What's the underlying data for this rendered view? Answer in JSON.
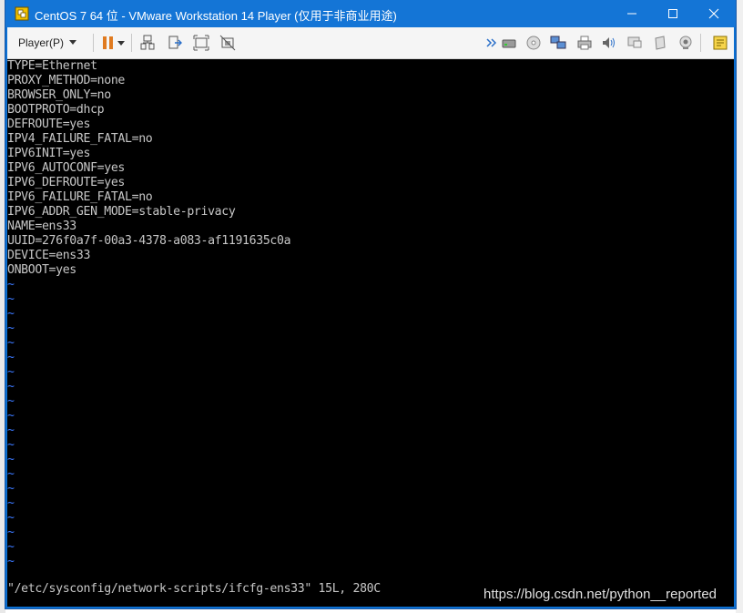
{
  "window": {
    "title": "CentOS 7 64 位 - VMware Workstation 14 Player (仅用于非商业用途)",
    "app_icon": "vmware-icon",
    "controls": [
      "minimize-icon",
      "maximize-icon",
      "close-icon"
    ]
  },
  "toolbar": {
    "player_menu": "Player(P)",
    "icons_left": [
      "pause-icon",
      "send-ctrl-alt-del-icon",
      "snapshot-icon",
      "fullscreen-icon",
      "unity-icon"
    ],
    "icons_right": [
      "more-icon",
      "hard-disk-icon",
      "cd-icon",
      "network-icon",
      "printer-icon",
      "sound-icon",
      "display-icon",
      "usb-icon",
      "camera-icon",
      "message-icon"
    ]
  },
  "terminal": {
    "lines": [
      "TYPE=Ethernet",
      "PROXY_METHOD=none",
      "BROWSER_ONLY=no",
      "BOOTPROTO=dhcp",
      "DEFROUTE=yes",
      "IPV4_FAILURE_FATAL=no",
      "IPV6INIT=yes",
      "IPV6_AUTOCONF=yes",
      "IPV6_DEFROUTE=yes",
      "IPV6_FAILURE_FATAL=no",
      "IPV6_ADDR_GEN_MODE=stable-privacy",
      "NAME=ens33",
      "UUID=276f0a7f-00a3-4378-a083-af1191635c0a",
      "DEVICE=ens33",
      "ONBOOT=yes"
    ],
    "empty_line_marker": "~",
    "empty_line_count": 20,
    "status": "\"/etc/sysconfig/network-scripts/ifcfg-ens33\" 15L, 280C"
  },
  "watermark": "https://blog.csdn.net/python__reported",
  "colors": {
    "titlebar": "#1475d6",
    "terminal_bg": "#000000",
    "terminal_fg": "#c7c7c7",
    "tilde": "#3b78ff",
    "pause_icon": "#e07a1f"
  }
}
